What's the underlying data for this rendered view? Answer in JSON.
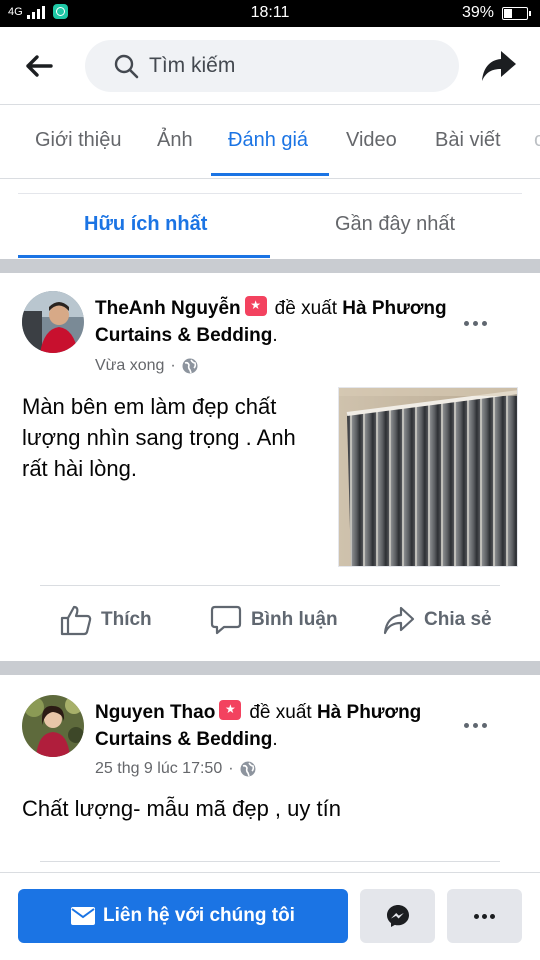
{
  "status_bar": {
    "signal_text": "4G",
    "time": "18:11",
    "battery_percent": "39%",
    "battery_level": 0.39
  },
  "header": {
    "search_placeholder": "Tìm kiếm",
    "icons": [
      "back-arrow-icon",
      "search-icon",
      "share-icon"
    ]
  },
  "tabs": [
    {
      "label": "Giới thiệu",
      "active": false
    },
    {
      "label": "Ảnh",
      "active": false
    },
    {
      "label": "Đánh giá",
      "active": true
    },
    {
      "label": "Video",
      "active": false
    },
    {
      "label": "Bài viết",
      "active": false
    }
  ],
  "sort_tabs": [
    {
      "label": "Hữu ích nhất",
      "active": true
    },
    {
      "label": "Gần đây nhất",
      "active": false
    }
  ],
  "reviews": [
    {
      "author": "TheAnh Nguyễn",
      "recommends_text": "đề xuất",
      "page_name": "Hà Phương Curtains & Bedding",
      "page_suffix": ".",
      "time": "Vừa xong",
      "dot": "·",
      "text": "Màn bên em làm đẹp chất lượng nhìn sang trọng . Anh rất hài lòng.",
      "has_photo": true,
      "actions": {
        "like": "Thích",
        "comment": "Bình luận",
        "share": "Chia sẻ"
      }
    },
    {
      "author": "Nguyen Thao",
      "recommends_text": "đề xuất",
      "page_name": "Hà Phương Curtains & Bedding",
      "page_suffix": ".",
      "time": "25 thg 9 lúc 17:50",
      "dot": "·",
      "text": "Chất lượng- mẫu mã đẹp , uy tín",
      "has_photo": false
    }
  ],
  "bottom_bar": {
    "contact_label": "Liên hệ với chúng tôi",
    "icons": [
      "envelope-icon",
      "messenger-icon",
      "more-icon"
    ]
  },
  "colors": {
    "accent": "#1b74e4",
    "badge": "#f3425f",
    "muted_text": "#65676b",
    "separator": "#c9ccd1"
  }
}
